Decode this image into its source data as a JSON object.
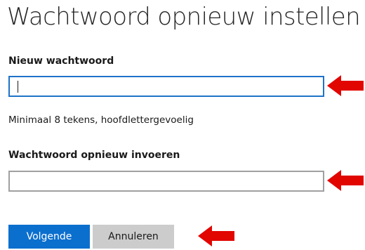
{
  "page": {
    "title": "Wachtwoord opnieuw instellen"
  },
  "form": {
    "new_password_label": "Nieuw wachtwoord",
    "new_password_value": "",
    "hint": "Minimaal 8 tekens, hoofdlettergevoelig",
    "confirm_password_label": "Wachtwoord opnieuw invoeren",
    "confirm_password_value": ""
  },
  "buttons": {
    "next_label": "Volgende",
    "cancel_label": "Annuleren"
  },
  "annotations": {
    "arrow_color": "#e10600",
    "arrow_icon": "red-arrow-left-icon"
  },
  "colors": {
    "primary_button": "#0b6fce",
    "focus_border": "#1e73c8",
    "secondary_button": "#cccccc"
  }
}
